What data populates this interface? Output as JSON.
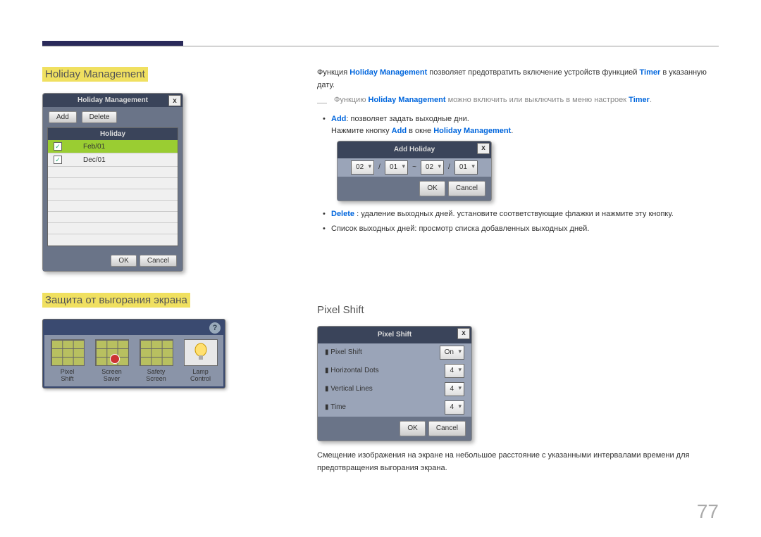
{
  "page_number": "77",
  "left": {
    "hm_heading": "Holiday Management",
    "burn_heading": "Защита от выгорания экрана",
    "hm_dialog": {
      "title": "Holiday Management",
      "add": "Add",
      "delete": "Delete",
      "col_header": "Holiday",
      "rows": [
        "Feb/01",
        "Dec/01"
      ],
      "ok": "OK",
      "cancel": "Cancel"
    },
    "burn_panel": {
      "items": [
        "Pixel\nShift",
        "Screen\nSaver",
        "Safety\nScreen",
        "Lamp\nControl"
      ]
    }
  },
  "right": {
    "intro_1a": "Функция ",
    "intro_1b": "Holiday Management",
    "intro_1c": " позволяет предотвратить включение устройств функцией ",
    "intro_1d": "Timer",
    "intro_1e": " в указанную дату.",
    "note_1a": "Функцию ",
    "note_1b": "Holiday Management",
    "note_1c": " можно включить или выключить в меню настроек ",
    "note_1d": "Timer",
    "note_1e": ".",
    "add_line_a": "Add",
    "add_line_b": ": позволяет задать выходные дни.",
    "add_line2_a": "Нажмите кнопку ",
    "add_line2_b": "Add",
    "add_line2_c": " в окне ",
    "add_line2_d": "Holiday Management",
    "add_line2_e": ".",
    "add_holiday": {
      "title": "Add Holiday",
      "m1": "02",
      "d1": "01",
      "sep": "~",
      "m2": "02",
      "d2": "01",
      "slash": "/",
      "ok": "OK",
      "cancel": "Cancel"
    },
    "delete_a": "Delete",
    "delete_b": " : удаление выходных дней. установите соответствующие флажки и нажмите эту кнопку.",
    "list_line": "Список выходных дней: просмотр списка добавленных выходных дней.",
    "pixel_shift_heading": "Pixel Shift",
    "pixel_dialog": {
      "title": "Pixel Shift",
      "r1": "Pixel Shift",
      "v1": "On",
      "r2": "Horizontal Dots",
      "v2": "4",
      "r3": "Vertical Lines",
      "v3": "4",
      "r4": "Time",
      "v4": "4",
      "ok": "OK",
      "cancel": "Cancel"
    },
    "pixel_desc": "Смещение изображения на экране на небольшое расстояние с указанными интервалами времени для предотвращения выгорания экрана."
  }
}
